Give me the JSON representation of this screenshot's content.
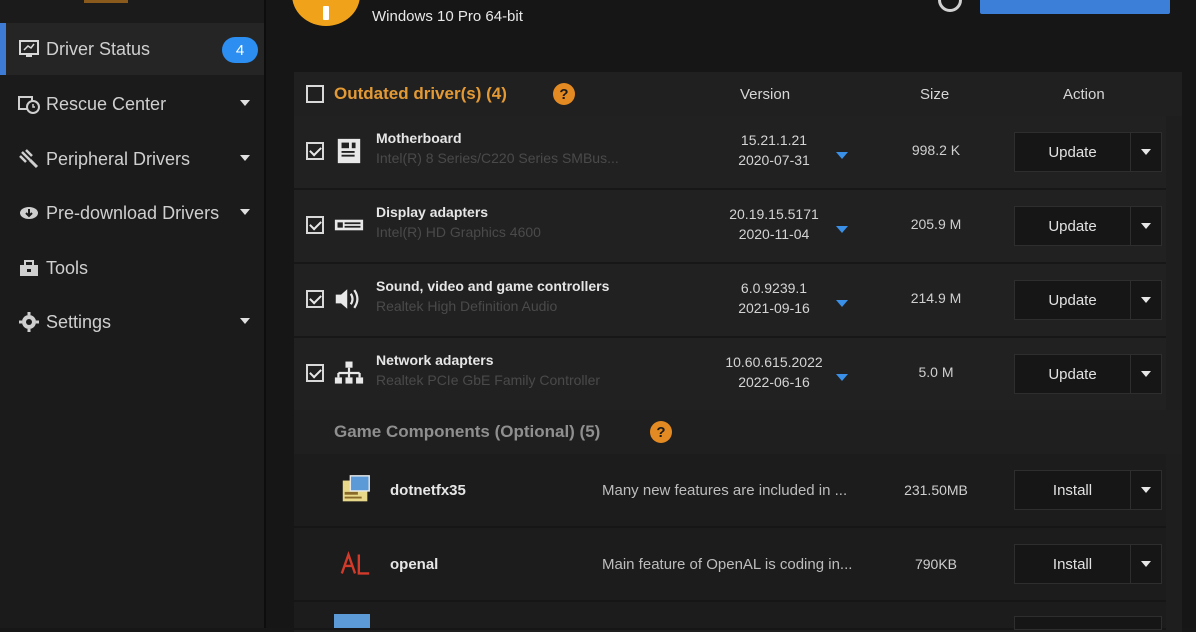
{
  "system": {
    "os": "Windows 10 Pro 64-bit"
  },
  "sidebar": {
    "items": [
      {
        "label": "Driver Status",
        "icon": "monitor-icon",
        "badge": "4",
        "active": true
      },
      {
        "label": "Rescue Center",
        "icon": "rescue-clock-icon",
        "dropdown": true
      },
      {
        "label": "Peripheral Drivers",
        "icon": "plug-icon",
        "dropdown": true
      },
      {
        "label": "Pre-download Drivers",
        "icon": "download-cloud-icon",
        "dropdown": true
      },
      {
        "label": "Tools",
        "icon": "toolbox-icon"
      },
      {
        "label": "Settings",
        "icon": "gear-icon",
        "dropdown": true
      }
    ]
  },
  "outdated": {
    "title": "Outdated driver(s) (4)",
    "columns": {
      "version": "Version",
      "size": "Size",
      "action": "Action"
    },
    "rows": [
      {
        "name": "Motherboard",
        "desc": "Intel(R) 8 Series/C220 Series SMBus...",
        "version": "15.21.1.21",
        "date": "2020-07-31",
        "size": "998.2 K",
        "action": "Update",
        "icon": "motherboard-icon"
      },
      {
        "name": "Display adapters",
        "desc": "Intel(R) HD Graphics 4600",
        "version": "20.19.15.5171",
        "date": "2020-11-04",
        "size": "205.9 M",
        "action": "Update",
        "icon": "display-card-icon"
      },
      {
        "name": "Sound, video and game controllers",
        "desc": "Realtek High Definition Audio",
        "version": "6.0.9239.1",
        "date": "2021-09-16",
        "size": "214.9 M",
        "action": "Update",
        "icon": "speaker-icon"
      },
      {
        "name": "Network adapters",
        "desc": "Realtek PCIe GbE Family Controller",
        "version": "10.60.615.2022",
        "date": "2022-06-16",
        "size": "5.0 M",
        "action": "Update",
        "icon": "network-icon"
      }
    ]
  },
  "game": {
    "title": "Game Components (Optional) (5)",
    "rows": [
      {
        "name": "dotnetfx35",
        "desc": "Many new features are included in ...",
        "size": "231.50MB",
        "action": "Install",
        "icon": "dotnet-package-icon"
      },
      {
        "name": "openal",
        "desc": "Main feature of OpenAL is coding in...",
        "size": "790KB",
        "action": "Install",
        "icon": "openal-logo-icon"
      }
    ]
  },
  "colors": {
    "accent": "#3d7bd6",
    "orange": "#e39a35",
    "badge": "#2b8ef0"
  }
}
